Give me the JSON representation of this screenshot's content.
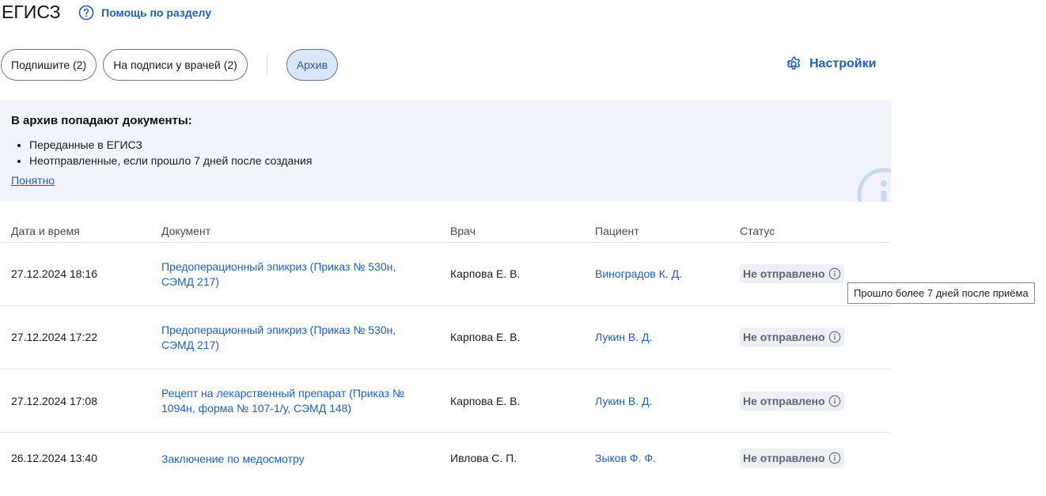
{
  "header": {
    "title": "ЕГИСЗ",
    "help_label": "Помощь по разделу"
  },
  "tabs": [
    {
      "label": "Подпишите (2)"
    },
    {
      "label": "На подписи у врачей (2)"
    },
    {
      "label": "Архив"
    }
  ],
  "settings_label": "Настройки",
  "info": {
    "title": "В архив попадают документы:",
    "items": [
      "Переданные в ЕГИСЗ",
      "Неотправленные, если прошло 7 дней после создания"
    ],
    "ok_label": "Понятно"
  },
  "table": {
    "columns": [
      "Дата и время",
      "Документ",
      "Врач",
      "Пациент",
      "Статус"
    ],
    "rows": [
      {
        "datetime": "27.12.2024 18:16",
        "document": "Предоперационный эпикриз (Приказ № 530н, СЭМД 217)",
        "doctor": "Карпова Е. В.",
        "patient": "Виноградов К. Д.",
        "status": "Не отправлено"
      },
      {
        "datetime": "27.12.2024 17:22",
        "document": "Предоперационный эпикриз (Приказ № 530н, СЭМД 217)",
        "doctor": "Карпова Е. В.",
        "patient": "Лукин В. Д.",
        "status": "Не отправлено"
      },
      {
        "datetime": "27.12.2024 17:08",
        "document": "Рецепт на лекарственный препарат (Приказ № 1094н, форма № 107-1/у, СЭМД 148)",
        "doctor": "Карпова Е. В.",
        "patient": "Лукин В. Д.",
        "status": "Не отправлено"
      },
      {
        "datetime": "26.12.2024 13:40",
        "document": "Заключение по медосмотру",
        "doctor": "Ивлова С. П.",
        "patient": "Зыков Ф. Ф.",
        "status": "Не отправлено"
      }
    ]
  },
  "tooltip": "Прошло более 7 дней после приёма",
  "colors": {
    "accent": "#1f5fbf",
    "banner_bg": "#f1f5fb",
    "active_tab_bg": "#dbe7f8",
    "status_bg": "#eceff3"
  }
}
